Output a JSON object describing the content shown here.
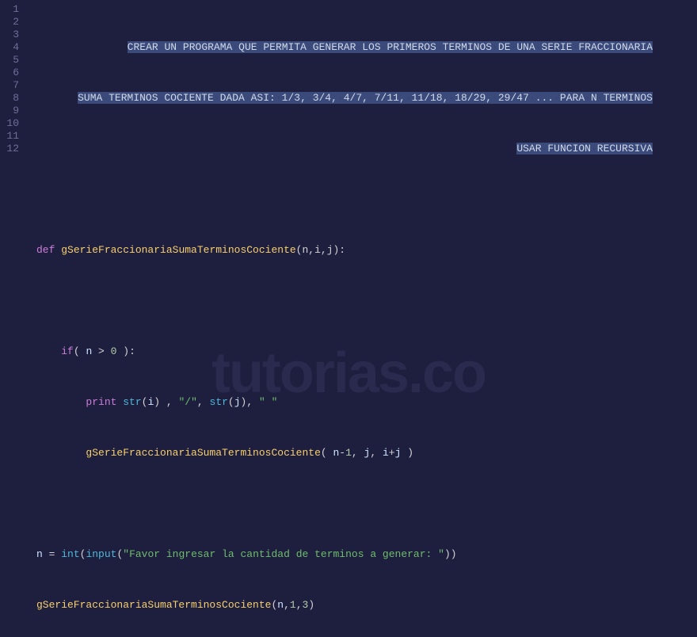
{
  "watermark": "tutorias.co",
  "gutter": [
    "1",
    "2",
    "3",
    "4",
    "5",
    "6",
    "7",
    "8",
    "9",
    "10",
    "11",
    "12"
  ],
  "code": {
    "c1": {
      "pfx": "                        ",
      "t1": "CREAR",
      "t2": "UN",
      "t3": "PROGRAMA",
      "t4": "QUE",
      "t5": "PERMITA",
      "t6": "GENERAR",
      "t7": "LOS",
      "t8": "PRIMEROS",
      "t9": "TERMINOS",
      "t10": "DE",
      "t11": "UNA",
      "t12": "SERIE",
      "t13": "FRACCIONARIA"
    },
    "c2": {
      "pfx": "                   ",
      "t1": "SUMA",
      "t2": "TERMINOS",
      "t3": "COCIENTE",
      "t4": "DADA",
      "t5": "ASI",
      "col": ":",
      "f1": "1/3",
      "f2": "3/4",
      "f3": "4/7",
      "f4": "7/11",
      "f5": "11/18",
      "f6": "18/29",
      "f7": "29/47",
      "ell": "...",
      "t6": "PARA",
      "t7": "N",
      "t8": "TERMINOS",
      "c": ",",
      "s": " "
    },
    "c3": {
      "pfx": "                                                                                                ",
      "t1": "USAR",
      "t2": "FUNCION",
      "t3": "RECURSIVA"
    },
    "l5": {
      "def": "def",
      "name": "gSerieFraccionariaSumaTerminosCociente",
      "params": "(n,i,j):"
    },
    "l7": {
      "indent": "    ",
      "if": "if",
      "open": "( ",
      "n": "n",
      "gt": " > ",
      "zero": "0",
      "close": " ):"
    },
    "l8": {
      "indent": "        ",
      "print": "print",
      "sp": " ",
      "str": "str",
      "o": "(",
      "c": ")",
      "i": "i",
      "j": "j",
      "cm": " , ",
      "cm2": ", ",
      "slash": "\"/\"",
      "space": "\" \""
    },
    "l9": {
      "indent": "        ",
      "name": "gSerieFraccionariaSumaTerminosCociente",
      "open": "( ",
      "n": "n",
      "minus": "-",
      "one": "1",
      "c": ", ",
      "j": "j",
      "i": "i",
      "plus": "+",
      "close": " )"
    },
    "l11": {
      "n": "n",
      "eq": " = ",
      "int": "int",
      "o": "(",
      "input": "input",
      "str": "\"Favor ingresar la cantidad de terminos a generar: \"",
      "c": ")",
      "c2": ")"
    },
    "l12": {
      "name": "gSerieFraccionariaSumaTerminosCociente",
      "o": "(",
      "n": "n",
      "cm": ",",
      "one": "1",
      "three": "3",
      "c": ")"
    }
  }
}
